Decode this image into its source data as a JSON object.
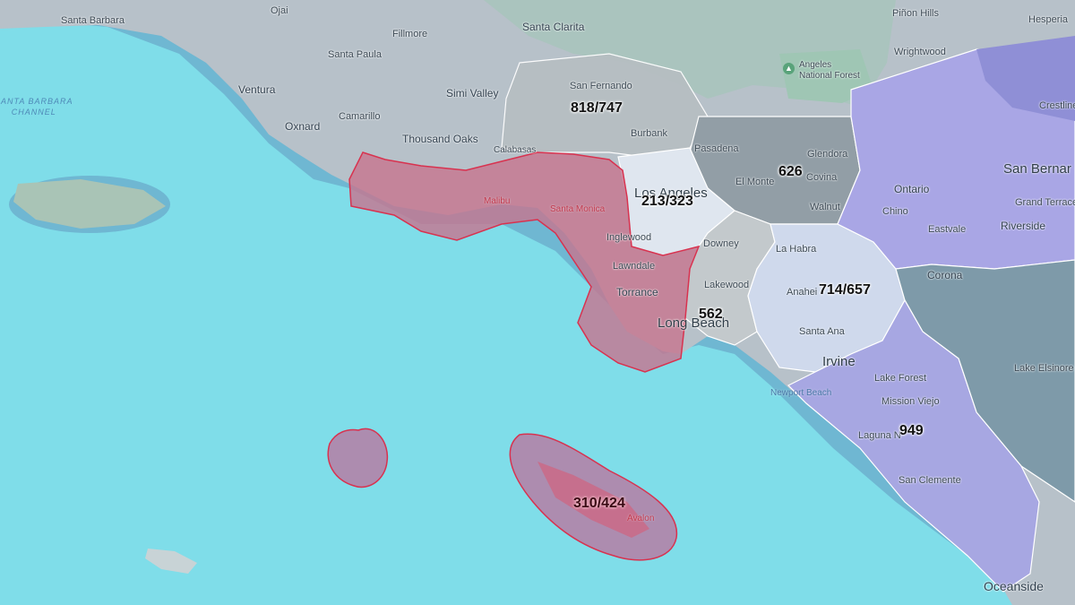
{
  "map": {
    "title": "",
    "colors": {
      "ocean": "#7fdde9",
      "land": "#b7c1c9",
      "selected_area_fill": "#c7748f",
      "selected_area_stroke": "#d8324f",
      "region_818": "#b6bec2",
      "region_213": "#dfe6ef",
      "region_626": "#929ea6",
      "region_562": "#c3c9cc",
      "region_714": "#cfd9ec",
      "region_949": "#a7a7e2",
      "region_909": "#a9a6e5",
      "region_951": "#7e9aa9"
    },
    "area_codes": [
      {
        "id": "818-747",
        "label": "818/747",
        "selected": false
      },
      {
        "id": "213-323",
        "label": "213/323",
        "selected": false
      },
      {
        "id": "626",
        "label": "626",
        "selected": false
      },
      {
        "id": "562",
        "label": "562",
        "selected": false
      },
      {
        "id": "714-657",
        "label": "714/657",
        "selected": false
      },
      {
        "id": "949",
        "label": "949",
        "selected": false
      },
      {
        "id": "310-424",
        "label": "310/424",
        "selected": true
      }
    ],
    "places": {
      "santa_barbara": "Santa Barbara",
      "ojai": "Ojai",
      "pinon_hills": "Piñon Hills",
      "hesperia": "Hesperia",
      "fillmore": "Fillmore",
      "santa_clarita": "Santa Clarita",
      "wrightwood": "Wrightwood",
      "santa_paula": "Santa Paula",
      "angeles_nf": "Angeles\nNational Forest",
      "ventura": "Ventura",
      "simi_valley": "Simi Valley",
      "san_fernando": "San Fernando",
      "crestline": "Crestline",
      "camarillo": "Camarillo",
      "oxnard": "Oxnard",
      "burbank": "Burbank",
      "thousand_oaks": "Thousand Oaks",
      "calabasas": "Calabasas",
      "pasadena": "Pasadena",
      "glendora": "Glendora",
      "covina": "Covina",
      "san_bernardino": "San Bernar",
      "el_monte": "El Monte",
      "los_angeles": "Los Angeles",
      "ontario": "Ontario",
      "malibu": "Malibu",
      "santa_monica": "Santa Monica",
      "walnut": "Walnut",
      "chino": "Chino",
      "grand_terrace": "Grand Terrace",
      "riverside": "Riverside",
      "inglewood": "Inglewood",
      "downey": "Downey",
      "eastvale": "Eastvale",
      "la_habra": "La Habra",
      "lawndale": "Lawndale",
      "corona": "Corona",
      "lakewood": "Lakewood",
      "torrance": "Torrance",
      "anaheim": "Anahei",
      "long_beach": "Long Beach",
      "santa_ana": "Santa Ana",
      "irvine": "Irvine",
      "lake_elsinore": "Lake Elsinore",
      "lake_forest": "Lake Forest",
      "newport_beach": "Newport Beach",
      "mission_viejo": "Mission Viejo",
      "laguna_niguel": "Laguna N",
      "san_clemente": "San Clemente",
      "avalon": "Avalon",
      "oceanside": "Oceanside",
      "sb_channel": "SANTA BARBARA\nCHANNEL"
    }
  }
}
